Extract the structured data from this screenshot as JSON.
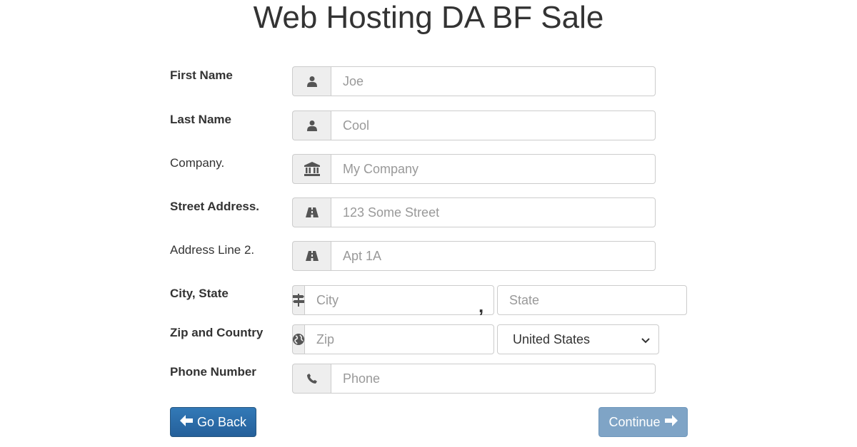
{
  "page": {
    "title": "Web Hosting DA BF Sale"
  },
  "form": {
    "first_name": {
      "label": "First Name",
      "placeholder": "Joe",
      "icon": "user-icon"
    },
    "last_name": {
      "label": "Last Name",
      "placeholder": "Cool",
      "icon": "user-icon"
    },
    "company": {
      "label": "Company.",
      "placeholder": "My Company",
      "icon": "bank-icon"
    },
    "street": {
      "label": "Street Address.",
      "placeholder": "123 Some Street",
      "icon": "road-icon"
    },
    "address2": {
      "label": "Address Line 2.",
      "placeholder": "Apt 1A",
      "icon": "road-icon"
    },
    "city_state": {
      "label": "City, State",
      "city_placeholder": "City",
      "separator": ",",
      "state_placeholder": "State",
      "icon": "signpost-icon"
    },
    "zip_country": {
      "label": "Zip and Country",
      "zip_placeholder": "Zip",
      "country_value": "United States",
      "icon": "globe-icon"
    },
    "phone": {
      "label": "Phone Number",
      "placeholder": "Phone",
      "icon": "phone-icon"
    }
  },
  "buttons": {
    "back_label": "Go Back",
    "continue_label": "Continue"
  },
  "colors": {
    "back_button": "#2f6fad",
    "continue_button": "#7fa4c6",
    "addon_background": "#eeeeee"
  }
}
